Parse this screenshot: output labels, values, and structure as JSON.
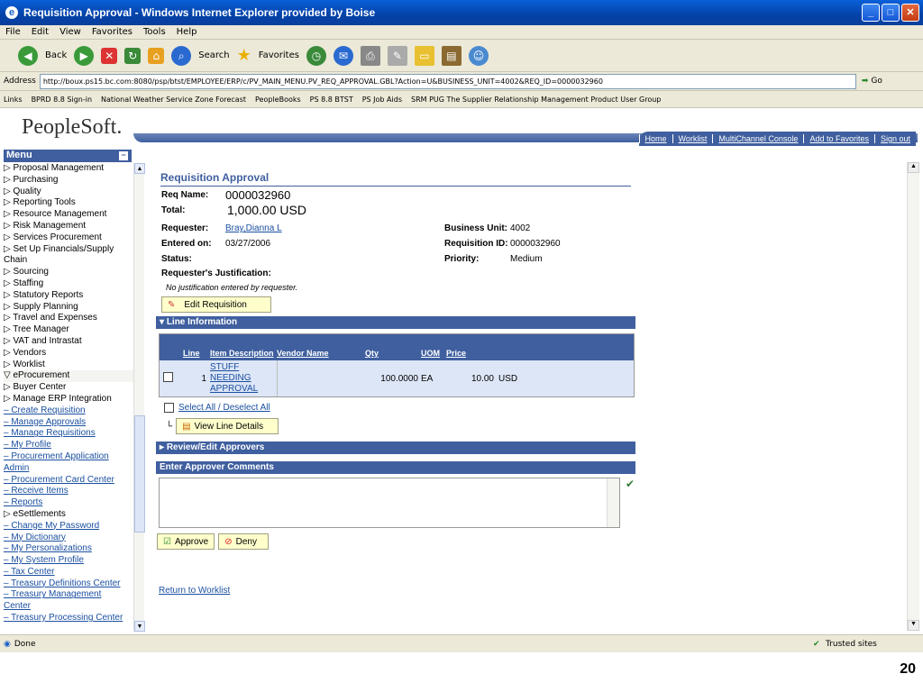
{
  "window": {
    "title": "Requisition Approval - Windows Internet Explorer provided by Boise"
  },
  "menubar": [
    "File",
    "Edit",
    "View",
    "Favorites",
    "Tools",
    "Help"
  ],
  "toolbar": {
    "back": "Back",
    "search": "Search",
    "favorites": "Favorites"
  },
  "address": {
    "label": "Address",
    "url": "http://boux.ps15.bc.com:8080/psp/btst/EMPLOYEE/ERP/c/PV_MAIN_MENU.PV_REQ_APPROVAL.GBL?Action=U&BUSINESS_UNIT=4002&REQ_ID=0000032960",
    "go": "Go"
  },
  "links": {
    "label": "Links",
    "items": [
      "BPRD 8.8 Sign-in",
      "National Weather Service Zone Forecast",
      "PeopleBooks",
      "PS 8.8 BTST",
      "PS Job Aids",
      "SRM PUG The Supplier Relationship Management Product User Group"
    ]
  },
  "brand": "PeopleSoft.",
  "toplinks": [
    "Home",
    "Worklist",
    "MultiChannel Console",
    "Add to Favorites",
    "Sign out"
  ],
  "menu": {
    "title": "Menu",
    "items": [
      {
        "t": "▷ Proposal Management",
        "l": false
      },
      {
        "t": "▷ Purchasing",
        "l": false
      },
      {
        "t": "▷ Quality",
        "l": false
      },
      {
        "t": "▷ Reporting Tools",
        "l": false
      },
      {
        "t": "▷ Resource Management",
        "l": false
      },
      {
        "t": "▷ Risk Management",
        "l": false
      },
      {
        "t": "▷ Services Procurement",
        "l": false
      },
      {
        "t": "▷ Set Up Financials/Supply",
        "l": false
      },
      {
        "t": "  Chain",
        "l": false
      },
      {
        "t": "▷ Sourcing",
        "l": false
      },
      {
        "t": "▷ Staffing",
        "l": false
      },
      {
        "t": "▷ Statutory Reports",
        "l": false
      },
      {
        "t": "▷ Supply Planning",
        "l": false
      },
      {
        "t": "▷ Travel and Expenses",
        "l": false
      },
      {
        "t": "▷ Tree Manager",
        "l": false
      },
      {
        "t": "▷ VAT and Intrastat",
        "l": false
      },
      {
        "t": "▷ Vendors",
        "l": false
      },
      {
        "t": "▷ Worklist",
        "l": false
      },
      {
        "t": "▽ eProcurement",
        "l": false
      },
      {
        "t": "  ▷ Buyer Center",
        "l": false
      },
      {
        "t": "  ▷ Manage ERP Integration",
        "l": false
      },
      {
        "t": "  – Create Requisition",
        "l": true
      },
      {
        "t": "  – Manage Approvals",
        "l": true
      },
      {
        "t": "  – Manage Requisitions",
        "l": true
      },
      {
        "t": "  – My Profile",
        "l": true
      },
      {
        "t": "  – Procurement Application",
        "l": true
      },
      {
        "t": "     Admin",
        "l": true
      },
      {
        "t": "  – Procurement Card Center",
        "l": true
      },
      {
        "t": "  – Receive Items",
        "l": true
      },
      {
        "t": "  – Reports",
        "l": true
      },
      {
        "t": "▷ eSettlements",
        "l": false
      },
      {
        "t": "– Change My Password",
        "l": true
      },
      {
        "t": "– My Dictionary",
        "l": true
      },
      {
        "t": "– My Personalizations",
        "l": true
      },
      {
        "t": "– My System Profile",
        "l": true
      },
      {
        "t": "– Tax Center",
        "l": true
      },
      {
        "t": "– Treasury Definitions Center",
        "l": true
      },
      {
        "t": "– Treasury Management",
        "l": true
      },
      {
        "t": "  Center",
        "l": true
      },
      {
        "t": "– Treasury Processing Center",
        "l": true
      }
    ]
  },
  "req": {
    "title": "Requisition Approval",
    "name_label": "Req Name:",
    "name": "0000032960",
    "total_label": "Total:",
    "total": "1,000.00 USD",
    "requester_label": "Requester:",
    "requester": "Bray,Dianna L",
    "entered_label": "Entered on:",
    "entered": "03/27/2006",
    "status_label": "Status:",
    "bu_label": "Business Unit:",
    "bu": "4002",
    "reqid_label": "Requisition ID:",
    "reqid": "0000032960",
    "priority_label": "Priority:",
    "priority": "Medium",
    "just_label": "Requester's Justification:",
    "just": "No justification entered by requester.",
    "edit_btn": "Edit Requisition"
  },
  "lines": {
    "section": "Line Information",
    "headers": [
      "Line",
      "Item Description",
      "Vendor Name",
      "Qty",
      "UOM",
      "Price"
    ],
    "row": {
      "line": "1",
      "desc1": "STUFF",
      "desc2": "NEEDING",
      "desc3": "APPROVAL",
      "vendor": "",
      "qty": "100.0000",
      "uom": "EA",
      "price": "10.00",
      "cur": "USD"
    },
    "select_all": "Select All / Deselect All",
    "view_btn": "View Line Details"
  },
  "review": "Review/Edit Approvers",
  "comments": "Enter Approver Comments",
  "approve": "Approve",
  "deny": "Deny",
  "return": "Return to Worklist",
  "status": {
    "text": "Done",
    "zone": "Trusted sites"
  },
  "pagenum": "20"
}
